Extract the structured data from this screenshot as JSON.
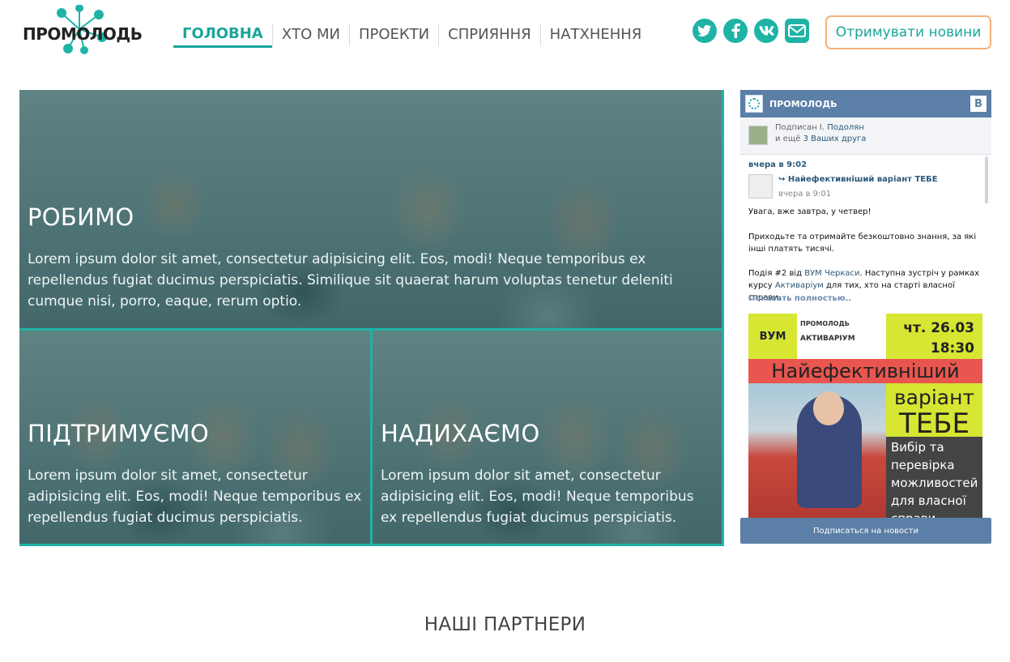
{
  "logo": {
    "text": "ПРОМОЛОДЬ"
  },
  "nav": {
    "items": [
      {
        "label": "ГОЛОВНА",
        "active": true
      },
      {
        "label": "ХТО МИ"
      },
      {
        "label": "ПРОЕКТИ"
      },
      {
        "label": "СПРИЯННЯ"
      },
      {
        "label": "НАТХНЕННЯ"
      }
    ]
  },
  "social": {
    "twitter": "twitter-icon",
    "facebook": "facebook-icon",
    "vk": "vk-icon",
    "mail": "mail-icon"
  },
  "header": {
    "subscribe_label": "Отримувати новини"
  },
  "tiles": {
    "main": {
      "title": "РОБИМО",
      "text": "Lorem ipsum dolor sit amet, consectetur adipisicing elit. Eos, modi! Neque temporibus ex repellendus fugiat ducimus perspiciatis. Similique sit quaerat harum voluptas tenetur deleniti cumque nisi, porro, eaque, rerum optio."
    },
    "left": {
      "title": "ПІДТРИМУЄМО",
      "text": "Lorem ipsum dolor sit amet, consectetur adipisicing elit. Eos, modi! Neque temporibus ex repellendus fugiat ducimus perspiciatis."
    },
    "right": {
      "title": "НАДИХАЄМО",
      "text": "Lorem ipsum dolor sit amet, consectetur adipisicing elit. Eos, modi! Neque temporibus ex repellendus fugiat ducimus perspiciatis."
    }
  },
  "vk": {
    "group_name": "ПРОМОЛОДЬ",
    "logo_letter": "В",
    "subs_prefix": "Подписан І.",
    "subs_name": "Подолян",
    "subs_more_prefix": "и ещё",
    "subs_more_link": "3 Ваших друга",
    "post_time": "вчера в 9:02",
    "repost_title": "Найефективніший варіант ТЕБЕ",
    "repost_time": "вчера в 9:01",
    "text1": "Увага, вже завтра, у четвер!",
    "text2": "Приходьте та отримайте безкоштовно знання, за які інші платять тисячі.",
    "text3_a": "Подія #2 від",
    "text3_link1": "ВУМ Черкаси",
    "text3_b": ". Наступна зустріч у рамках курсу",
    "text3_link2": "Активаріум",
    "text3_c": "для тих, хто на старті власної справи.",
    "show_more": "Показать полностью..",
    "poster": {
      "vum": "ВУМ",
      "promo": "ПРОМОЛОДЬ",
      "activarium": "АКТИВАРІУМ",
      "date": "чт. 26.03",
      "time": "18:30",
      "headline": "Найефективніший",
      "variant": "варіант",
      "tebe": "ТЕБЕ",
      "desc": "Вибір та перевірка можливостей для власної справи"
    },
    "subscribe_button": "Подписаться на новости"
  },
  "partners": {
    "title": "НАШІ ПАРТНЕРИ"
  }
}
